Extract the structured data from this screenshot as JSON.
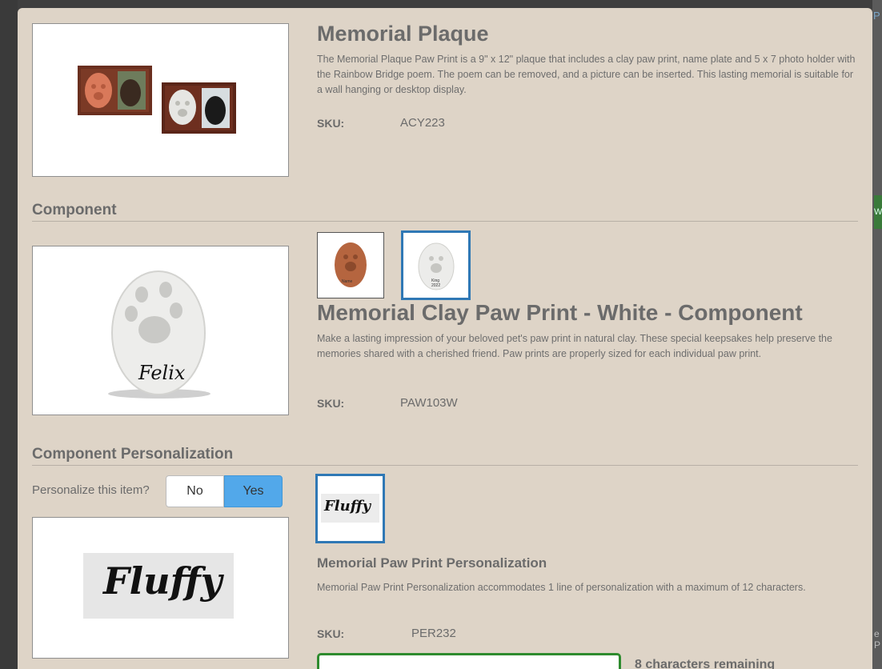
{
  "backdrop": {
    "right_letter": "P",
    "green_letter": "W",
    "bottom_letters": "e\nP"
  },
  "product": {
    "title": "Memorial Plaque",
    "description": "The Memorial Plaque Paw Print is a 9\" x 12\" plaque that includes a clay paw print, name plate and 5 x 7 photo holder with the Rainbow Bridge poem. The poem can be removed, and a picture can be inserted. This lasting memorial is suitable for a wall hanging or desktop display.",
    "sku_label": "SKU:",
    "sku": "ACY223"
  },
  "component": {
    "heading": "Component",
    "title": "Memorial Clay Paw Print - White - Component",
    "description": "Make a lasting impression of your beloved pet's paw print in natural clay. These special keepsakes help preserve the memories shared with a cherished friend. Paw prints are properly sized for each individual paw print.",
    "sku_label": "SKU:",
    "sku": "PAW103W",
    "image_name_text": "Felix",
    "thumb_terracotta_text": "Name",
    "thumb_white_text": "King\n2022",
    "selected_variant": "white"
  },
  "personalization": {
    "heading": "Component Personalization",
    "prompt": "Personalize this item?",
    "no_label": "No",
    "yes_label": "Yes",
    "selected_option": "Yes",
    "image_text": "Fluffy",
    "thumb_text": "Fluffy",
    "title": "Memorial Paw Print Personalization",
    "description": "Memorial Paw Print Personalization accommodates 1 line of personalization with a maximum of 12 characters.",
    "sku_label": "SKU:",
    "sku": "PER232",
    "input_value": "",
    "chars_remaining": "8 characters remaining"
  },
  "colors": {
    "modal_bg": "#ded4c7",
    "selected_border": "#2f78b5",
    "yes_button": "#52a8ea",
    "input_border": "#2e8b2e"
  }
}
